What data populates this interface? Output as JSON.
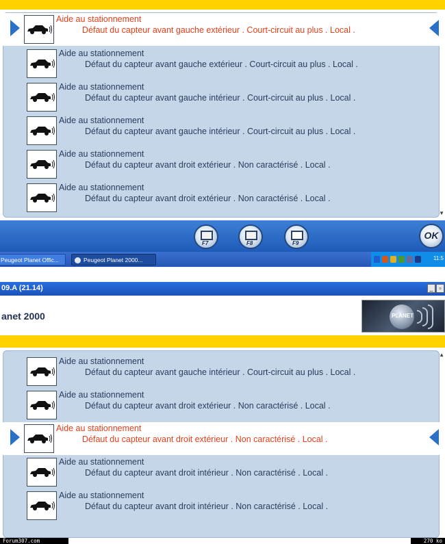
{
  "screen1": {
    "rows": [
      {
        "title": "Aide au stationnement",
        "detail": "Défaut du capteur avant gauche extérieur . Court-circuit au plus . Local ."
      },
      {
        "title": "Aide au stationnement",
        "detail": "Défaut du capteur avant gauche extérieur . Court-circuit au plus . Local ."
      },
      {
        "title": "Aide au stationnement",
        "detail": "Défaut du capteur avant gauche intérieur . Court-circuit au plus . Local ."
      },
      {
        "title": "Aide au stationnement",
        "detail": "Défaut du capteur avant gauche intérieur . Court-circuit au plus . Local ."
      },
      {
        "title": "Aide au stationnement",
        "detail": "Défaut du capteur avant droit extérieur . Non caractérisé . Local ."
      },
      {
        "title": "Aide au stationnement",
        "detail": "Défaut du capteur avant droit extérieur . Non caractérisé . Local ."
      }
    ],
    "selected_row": 0
  },
  "toolbar": {
    "buttons": [
      {
        "key": "F7",
        "icon": "exit-icon"
      },
      {
        "key": "F8",
        "icon": "printer-icon"
      },
      {
        "key": "F9",
        "icon": "document-icon"
      }
    ],
    "ok_label": "OK"
  },
  "taskbar": {
    "tasks": [
      "Peugeot Planet Offic...",
      "Peugeot Planet 2000..."
    ],
    "clock": "11:5"
  },
  "window": {
    "title": "09.A (21.14)",
    "app_name": "anet 2000",
    "logo_text": "PLANET"
  },
  "screen2": {
    "rows": [
      {
        "title": "Aide au stationnement",
        "detail": "Défaut du capteur avant gauche intérieur . Court-circuit au plus . Local ."
      },
      {
        "title": "Aide au stationnement",
        "detail": "Défaut du capteur avant droit extérieur . Non caractérisé . Local ."
      },
      {
        "title": "Aide au stationnement",
        "detail": "Défaut du capteur avant droit extérieur . Non caractérisé . Local ."
      },
      {
        "title": "Aide au stationnement",
        "detail": "Défaut du capteur avant droit intérieur . Non caractérisé . Local ."
      },
      {
        "title": "Aide au stationnement",
        "detail": "Défaut du capteur avant droit intérieur . Non caractérisé . Local ."
      }
    ],
    "selected_row": 2
  },
  "footer": {
    "left": "Forum307.com",
    "right": "270 ko"
  },
  "colors": {
    "accent_yellow": "#ffd200",
    "list_bg": "#c4d6e8",
    "selected_text": "#e4401a",
    "normal_text": "#2a3c5a",
    "toolbar_blue": "#1e5bb8"
  }
}
